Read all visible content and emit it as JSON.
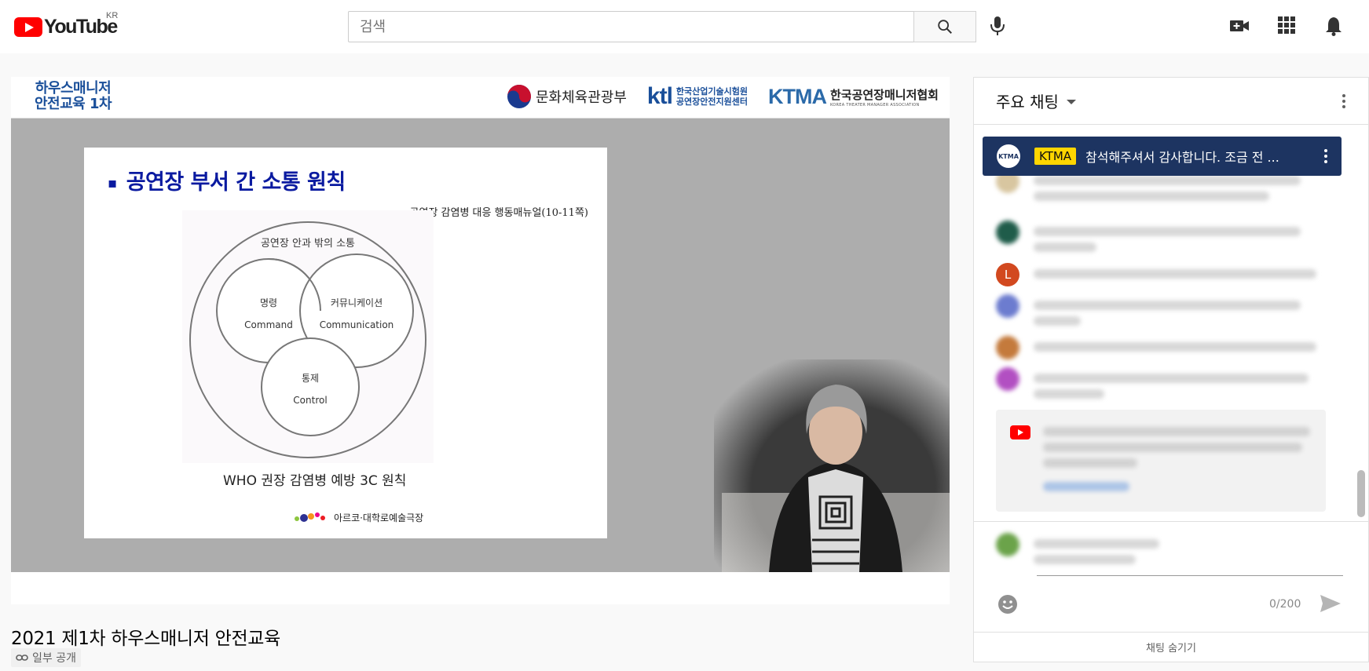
{
  "masthead": {
    "logo_text": "YouTube",
    "country": "KR",
    "search_placeholder": "검색"
  },
  "video": {
    "header_title_line1": "하우스매니저",
    "header_title_line2": "안전교육 1차",
    "logo_mcst": "문화체육관광부",
    "logo_ktl": "ktl",
    "logo_ktl_line1": "한국산업기술시험원",
    "logo_ktl_line2": "공연장안전지원센터",
    "logo_ktma": "KTMA",
    "logo_ktma_line1": "한국공연장매니저협회",
    "logo_ktma_line2": "KOREA THEATER MANAGER ASSOCIATION",
    "slide": {
      "bullet": "▪",
      "title": "공연장 부서 간 소통 원칙",
      "subtitle": "공연장 감염병 대응 행동매뉴얼(10-11쪽)",
      "outer_label": "공연장 안과 밖의 소통",
      "c1_ko": "명령",
      "c1_en": "Command",
      "c2_ko": "커뮤니케이션",
      "c2_en": "Communication",
      "c3_ko": "통제",
      "c3_en": "Control",
      "caption": "WHO  권장 감염병 예방 3C 원칙",
      "footer_logo": "아르코·대학로예술극장"
    }
  },
  "video_title": "2021 제1차 하우스매니저 안전교육",
  "privacy": "일부 공개",
  "chat": {
    "title": "주요 채팅",
    "pinned_badge": "KTMA",
    "pinned_avatar": "KTMA",
    "pinned_message": "참석해주셔서 감사합니다. 조금 전 ...",
    "counter": "0/200",
    "hide": "채팅 숨기기",
    "avatar_letter": "L"
  },
  "colors": {
    "brand_red": "#ff0000",
    "pinned_bg": "#1d3461",
    "badge": "#ffd600"
  }
}
